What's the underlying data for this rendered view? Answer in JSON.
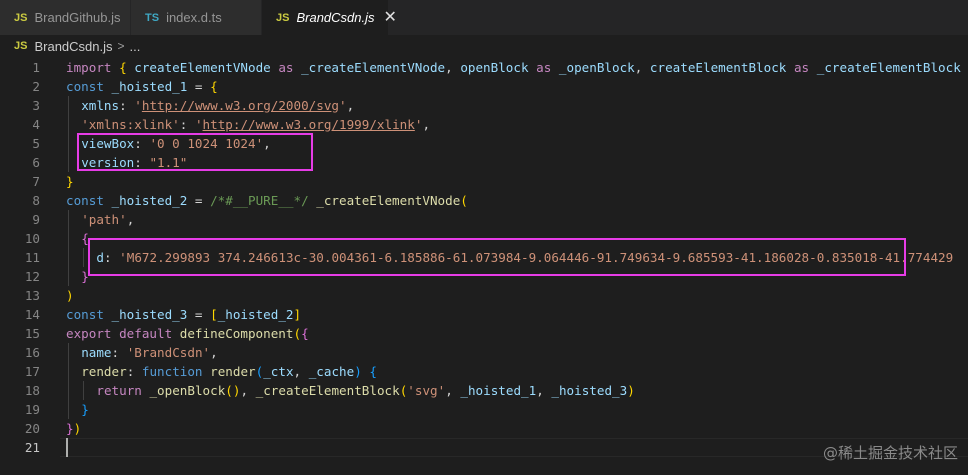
{
  "tabs": [
    {
      "label": "BrandGithub.js",
      "type": "JS"
    },
    {
      "label": "index.d.ts",
      "type": "TS"
    },
    {
      "label": "BrandCsdn.js",
      "type": "JS",
      "close": "✕"
    }
  ],
  "breadcrumb": {
    "file": "BrandCsdn.js",
    "file_type": "JS",
    "sep": ">",
    "rest": "..."
  },
  "lines": [
    {
      "n": "1",
      "t": [
        [
          "kw",
          "import "
        ],
        [
          "b1",
          "{ "
        ],
        [
          "vr",
          "createElementVNode"
        ],
        [
          "kw",
          " as "
        ],
        [
          "vr",
          "_createElementVNode"
        ],
        [
          "pl",
          ", "
        ],
        [
          "vr",
          "openBlock"
        ],
        [
          "kw",
          " as "
        ],
        [
          "vr",
          "_openBlock"
        ],
        [
          "pl",
          ", "
        ],
        [
          "vr",
          "createElementBlock"
        ],
        [
          "kw",
          " as "
        ],
        [
          "vr",
          "_createElementBlock"
        ]
      ]
    },
    {
      "n": "2",
      "t": [
        [
          "st",
          "const "
        ],
        [
          "vr",
          "_hoisted_1"
        ],
        [
          "pl",
          " = "
        ],
        [
          "b1",
          "{"
        ]
      ]
    },
    {
      "n": "3",
      "t": [
        [
          "pr",
          "xmlns"
        ],
        [
          "pl",
          ": "
        ],
        [
          "str",
          "'"
        ],
        [
          "str url",
          "http://www.w3.org/2000/svg"
        ],
        [
          "str",
          "'"
        ],
        [
          "pl",
          ","
        ]
      ]
    },
    {
      "n": "4",
      "t": [
        [
          "str",
          "'xmlns:xlink'"
        ],
        [
          "pl",
          ": "
        ],
        [
          "str",
          "'"
        ],
        [
          "str url",
          "http://www.w3.org/1999/xlink"
        ],
        [
          "str",
          "'"
        ],
        [
          "pl",
          ","
        ]
      ]
    },
    {
      "n": "5",
      "t": [
        [
          "pr",
          "viewBox"
        ],
        [
          "pl",
          ": "
        ],
        [
          "str",
          "'0 0 1024 1024'"
        ],
        [
          "pl",
          ","
        ]
      ]
    },
    {
      "n": "6",
      "t": [
        [
          "pr",
          "version"
        ],
        [
          "pl",
          ": "
        ],
        [
          "str",
          "\"1.1\""
        ]
      ]
    },
    {
      "n": "7",
      "t": [
        [
          "b1",
          "}"
        ]
      ]
    },
    {
      "n": "8",
      "t": [
        [
          "st",
          "const "
        ],
        [
          "vr",
          "_hoisted_2"
        ],
        [
          "pl",
          " = "
        ],
        [
          "cm",
          "/*#__PURE__*/ "
        ],
        [
          "fn",
          "_createElementVNode"
        ],
        [
          "b1",
          "("
        ]
      ]
    },
    {
      "n": "9",
      "t": [
        [
          "str",
          "'path'"
        ],
        [
          "pl",
          ","
        ]
      ]
    },
    {
      "n": "10",
      "t": [
        [
          "b2",
          "{"
        ]
      ]
    },
    {
      "n": "11",
      "t": [
        [
          "pr",
          "d"
        ],
        [
          "pl",
          ": "
        ],
        [
          "str",
          "'M672.299893 374.246613c-30.004361-6.185886-61.073984-9.064446-91.749634-9.685593-41.186028-0.835018-41.774429"
        ]
      ]
    },
    {
      "n": "12",
      "t": [
        [
          "b2",
          "}"
        ]
      ]
    },
    {
      "n": "13",
      "t": [
        [
          "b1",
          ")"
        ]
      ]
    },
    {
      "n": "14",
      "t": [
        [
          "st",
          "const "
        ],
        [
          "vr",
          "_hoisted_3"
        ],
        [
          "pl",
          " = "
        ],
        [
          "b1",
          "["
        ],
        [
          "vr",
          "_hoisted_2"
        ],
        [
          "b1",
          "]"
        ]
      ]
    },
    {
      "n": "15",
      "t": [
        [
          "kw",
          "export default "
        ],
        [
          "fn",
          "defineComponent"
        ],
        [
          "b1",
          "("
        ],
        [
          "b2",
          "{"
        ]
      ]
    },
    {
      "n": "16",
      "t": [
        [
          "pr",
          "name"
        ],
        [
          "pl",
          ": "
        ],
        [
          "str",
          "'BrandCsdn'"
        ],
        [
          "pl",
          ","
        ]
      ]
    },
    {
      "n": "17",
      "t": [
        [
          "fn",
          "render"
        ],
        [
          "pl",
          ": "
        ],
        [
          "st",
          "function "
        ],
        [
          "fn",
          "render"
        ],
        [
          "b3",
          "("
        ],
        [
          "vr",
          "_ctx"
        ],
        [
          "pl",
          ", "
        ],
        [
          "vr",
          "_cache"
        ],
        [
          "b3",
          ")"
        ],
        [
          "pl",
          " "
        ],
        [
          "b3",
          "{"
        ]
      ]
    },
    {
      "n": "18",
      "t": [
        [
          "kw",
          "return "
        ],
        [
          "fn",
          "_openBlock"
        ],
        [
          "b1",
          "()"
        ],
        [
          "pl",
          ", "
        ],
        [
          "fn",
          "_createElementBlock"
        ],
        [
          "b1",
          "("
        ],
        [
          "str",
          "'svg'"
        ],
        [
          "pl",
          ", "
        ],
        [
          "vr",
          "_hoisted_1"
        ],
        [
          "pl",
          ", "
        ],
        [
          "vr",
          "_hoisted_3"
        ],
        [
          "b1",
          ")"
        ]
      ]
    },
    {
      "n": "19",
      "t": [
        [
          "b3",
          "}"
        ]
      ]
    },
    {
      "n": "20",
      "t": [
        [
          "b2",
          "}"
        ],
        [
          "b1",
          ")"
        ]
      ]
    },
    {
      "n": "21",
      "t": []
    }
  ],
  "watermark": "@稀土掘金技术社区"
}
